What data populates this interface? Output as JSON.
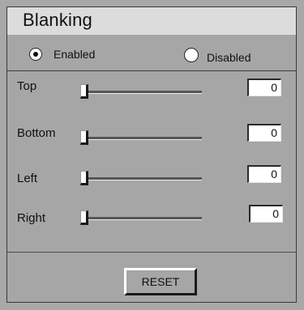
{
  "title": "Blanking",
  "mode": {
    "enabled_label": "Enabled",
    "disabled_label": "Disabled",
    "selected": "enabled"
  },
  "sliders": [
    {
      "label": "Top",
      "value": "0"
    },
    {
      "label": "Bottom",
      "value": "0"
    },
    {
      "label": "Left",
      "value": "0"
    },
    {
      "label": "Right",
      "value": "0"
    }
  ],
  "reset_label": "RESET",
  "colors": {
    "background": "#a6a6a6",
    "title_bar": "#dcdcdc"
  }
}
